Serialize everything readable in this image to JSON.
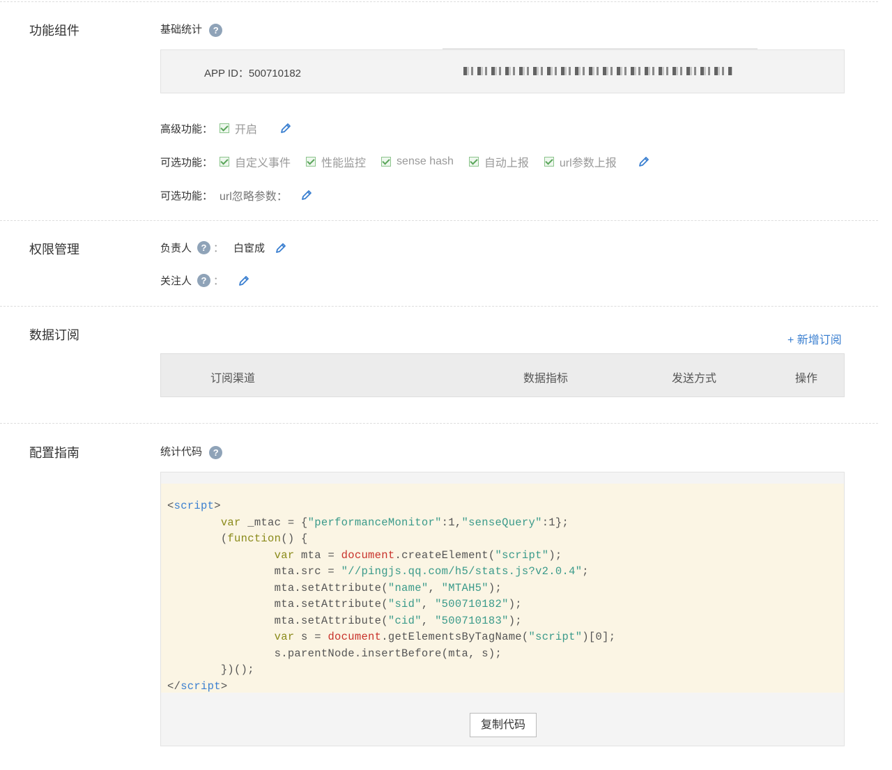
{
  "sections": {
    "features": "功能组件",
    "permissions": "权限管理",
    "subscription": "数据订阅",
    "guide": "配置指南"
  },
  "basic_stats": {
    "title": "基础统计",
    "app_id_label": "APP ID：",
    "app_id": "500710182"
  },
  "advanced": {
    "label": "高级功能：",
    "options": [
      "开启"
    ]
  },
  "optional": {
    "label": "可选功能：",
    "options": [
      "自定义事件",
      "性能监控",
      "sense hash",
      "自动上报",
      "url参数上报"
    ]
  },
  "optional2": {
    "label": "可选功能：",
    "value": "url忽略参数："
  },
  "permissions": {
    "owner_label": "负责人",
    "owner_sep": "：",
    "owner": "白宦成",
    "follower_label": "关注人",
    "follower_sep": "："
  },
  "subscription": {
    "add_label": "+ 新增订阅",
    "columns": [
      "订阅渠道",
      "数据指标",
      "发送方式",
      "操作"
    ]
  },
  "guide": {
    "title": "统计代码",
    "copy_label": "复制代码",
    "code": {
      "l1a": "<",
      "l1b": "script",
      "l1c": ">",
      "l2a": "var",
      "l2b": " _mtac = {",
      "l2c": "\"performanceMonitor\"",
      "l2d": ":1,",
      "l2e": "\"senseQuery\"",
      "l2f": ":1};",
      "l3a": "(",
      "l3b": "function",
      "l3c": "() {",
      "l4a": "var",
      "l4b": " mta = ",
      "l4c": "document",
      "l4d": ".createElement(",
      "l4e": "\"script\"",
      "l4f": ");",
      "l5a": "mta.src = ",
      "l5b": "\"//pingjs.qq.com/h5/stats.js?v2.0.4\"",
      "l5c": ";",
      "l6a": "mta.setAttribute(",
      "l6b": "\"name\"",
      "l6c": ", ",
      "l6d": "\"MTAH5\"",
      "l6e": ");",
      "l7a": "mta.setAttribute(",
      "l7b": "\"sid\"",
      "l7c": ", ",
      "l7d": "\"500710182\"",
      "l7e": ");",
      "l8a": "mta.setAttribute(",
      "l8b": "\"cid\"",
      "l8c": ", ",
      "l8d": "\"500710183\"",
      "l8e": ");",
      "l9a": "var",
      "l9b": " s = ",
      "l9c": "document",
      "l9d": ".getElementsByTagName(",
      "l9e": "\"script\"",
      "l9f": ")[0];",
      "l10": "s.parentNode.insertBefore(mta, s);",
      "l11": "})();",
      "l12a": "</",
      "l12b": "script",
      "l12c": ">"
    }
  },
  "colors": {
    "accent": "#3a7fd0",
    "check": "#5aa55a",
    "code_bg": "#fbf5e4"
  }
}
